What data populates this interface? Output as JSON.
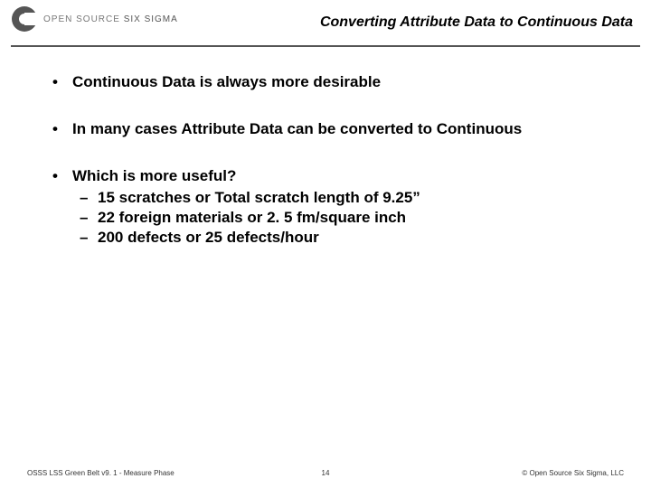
{
  "logo": {
    "text_light": "OPEN SOURCE",
    "text_bold": "SIX SIGMA"
  },
  "title": "Converting Attribute Data to Continuous Data",
  "bullets": [
    {
      "text": "Continuous Data is always more desirable"
    },
    {
      "text": "In many cases Attribute Data can be converted to Continuous"
    },
    {
      "text": "Which is more useful?",
      "sub": [
        "15 scratches or Total scratch length of 9.25”",
        "22 foreign materials or 2. 5 fm/square inch",
        "200 defects or 25 defects/hour"
      ]
    }
  ],
  "footer": {
    "left": "OSSS LSS Green Belt v9. 1 - Measure Phase",
    "center": "14",
    "right": "© Open Source Six Sigma, LLC"
  }
}
